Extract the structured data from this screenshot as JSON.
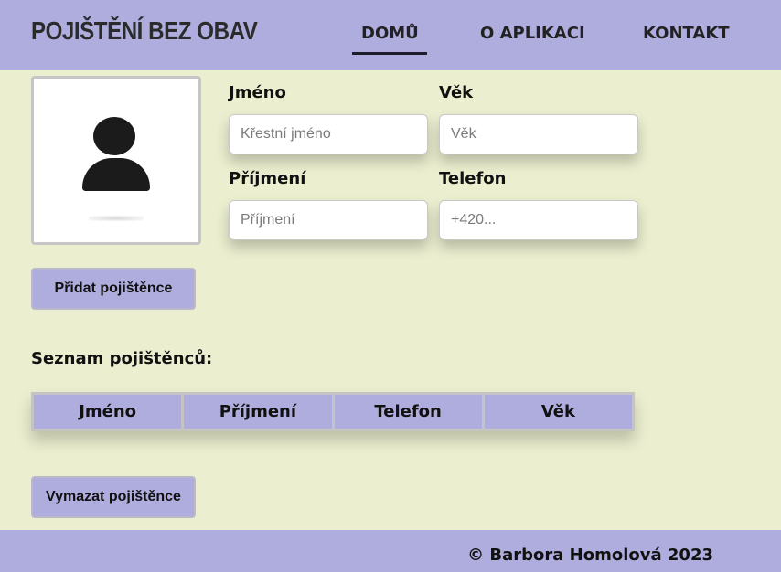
{
  "header": {
    "brand": "POJIŠTĚNÍ BEZ OBAV",
    "nav": [
      {
        "label": "DOMŮ",
        "active": true
      },
      {
        "label": "O APLIKACI",
        "active": false
      },
      {
        "label": "KONTAKT",
        "active": false
      }
    ]
  },
  "avatar": {
    "icon": "user-icon"
  },
  "form": {
    "first_name": {
      "label": "Jméno",
      "placeholder": "Křestní jméno",
      "value": ""
    },
    "age": {
      "label": "Věk",
      "placeholder": "Věk",
      "value": ""
    },
    "last_name": {
      "label": "Příjmení",
      "placeholder": "Příjmení",
      "value": ""
    },
    "phone": {
      "label": "Telefon",
      "placeholder": "+420...",
      "value": ""
    },
    "add_button": "Přidat pojištěnce"
  },
  "list": {
    "title": "Seznam pojištěnců:",
    "columns": [
      "Jméno",
      "Příjmení",
      "Telefon",
      "Věk"
    ],
    "rows": [],
    "clear_button": "Vymazat pojištěnce"
  },
  "footer": {
    "text": "© Barbora Homolová 2023"
  },
  "colors": {
    "background": "#ebeecf",
    "accent": "#afadde"
  }
}
